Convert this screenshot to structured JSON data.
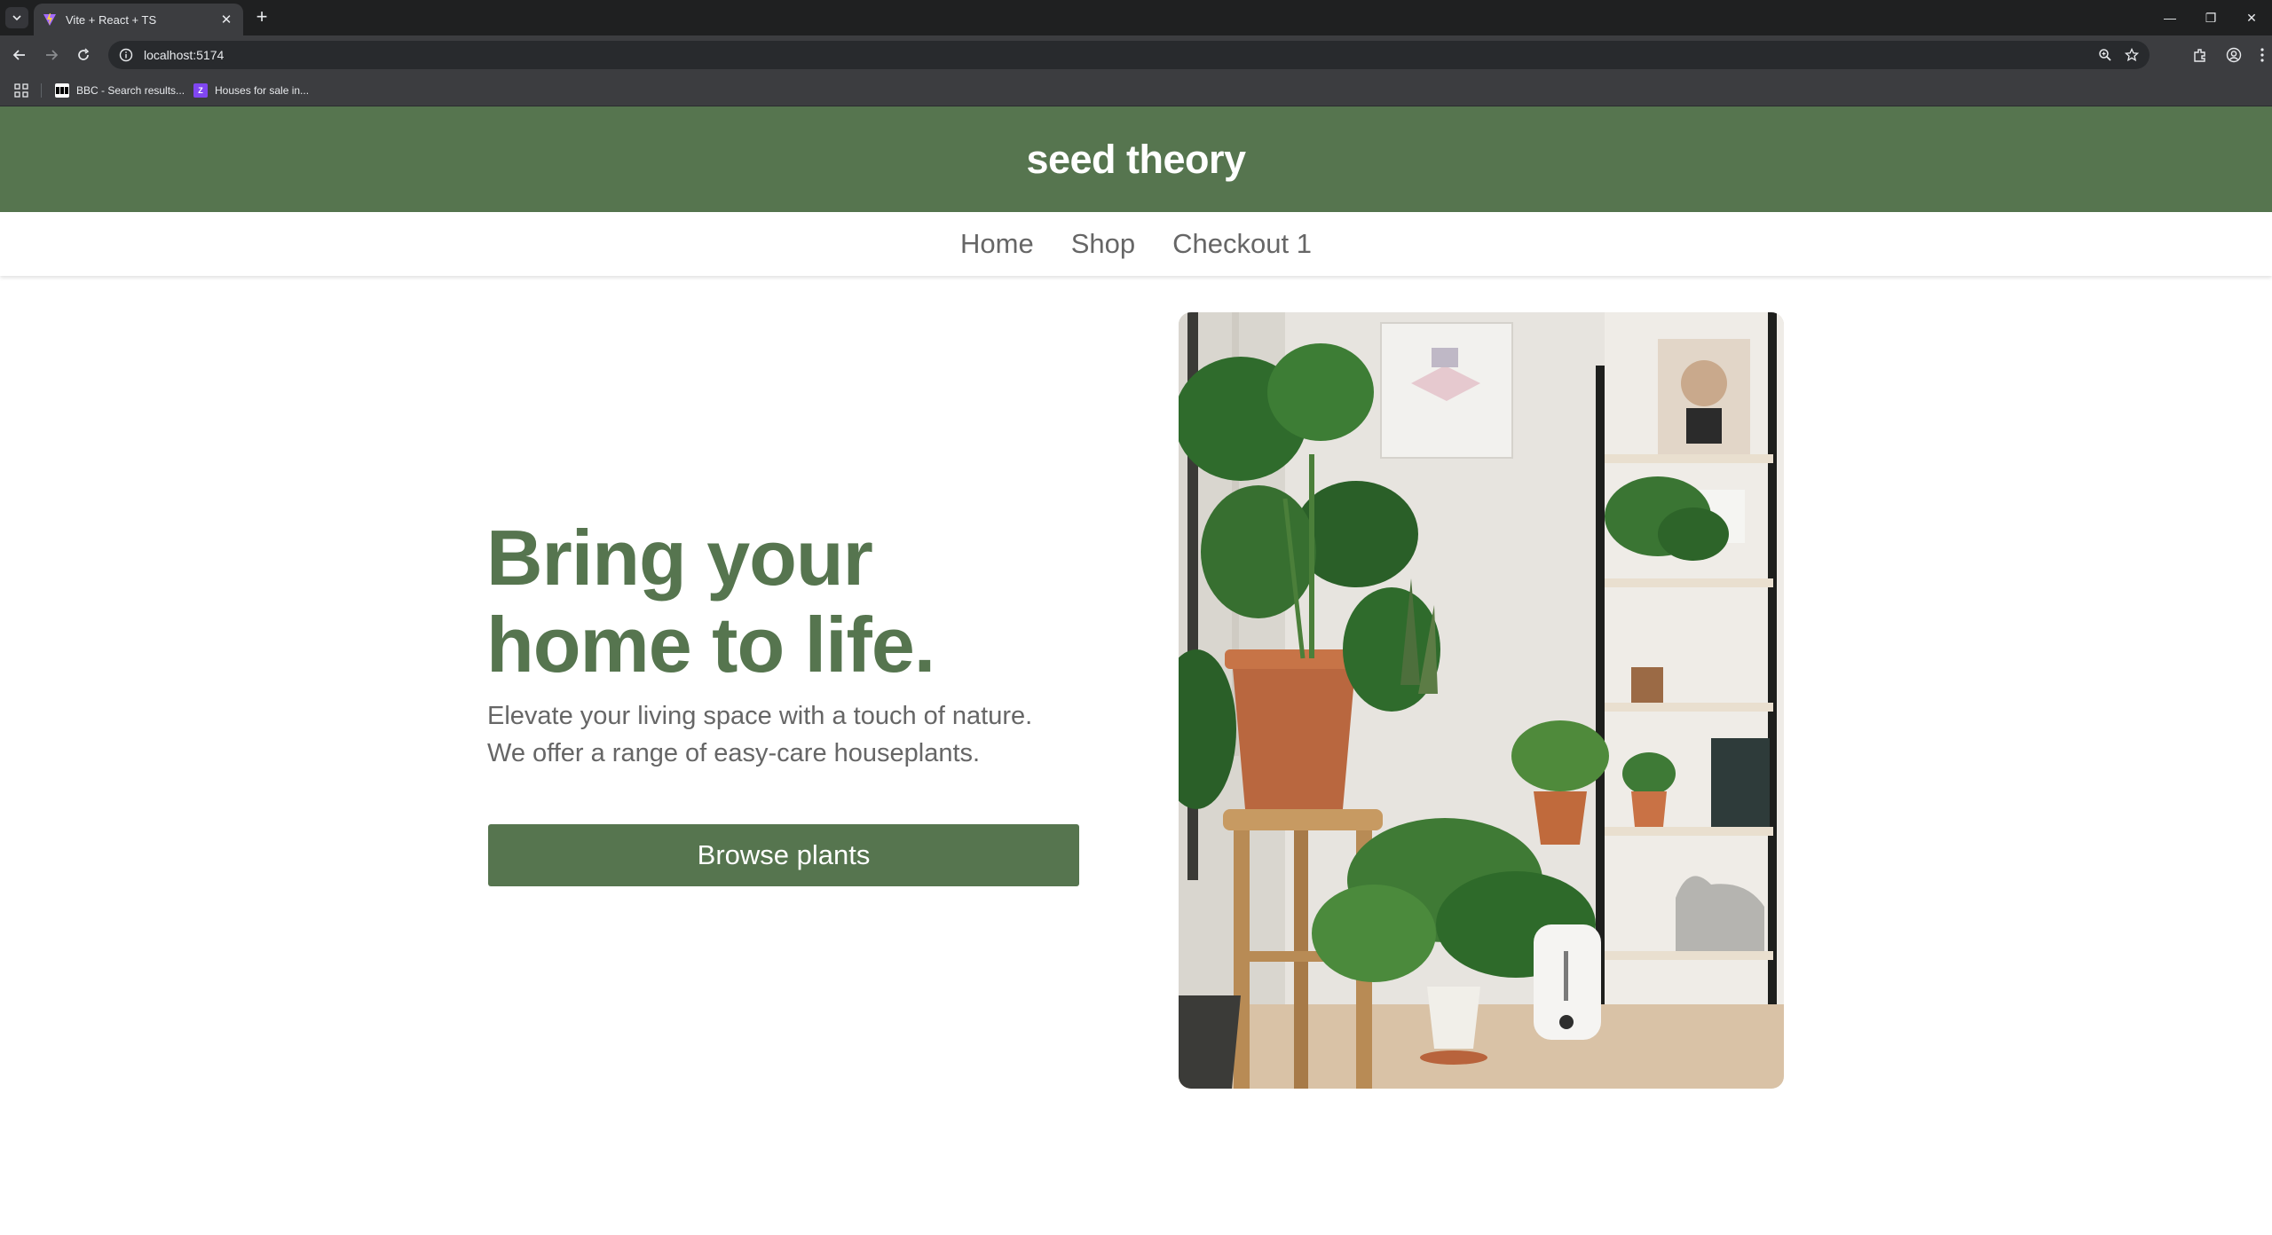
{
  "browser": {
    "tab_title": "Vite + React + TS",
    "url": "localhost:5174",
    "bookmarks": [
      {
        "label": "BBC - Search results...",
        "icon": "bbc-icon"
      },
      {
        "label": "Houses for sale in...",
        "icon": "zoopla-icon",
        "icon_text": "Z"
      }
    ]
  },
  "header": {
    "brand": "seed theory",
    "color": "#56754f"
  },
  "nav": {
    "items": [
      "Home",
      "Shop",
      "Checkout 1"
    ]
  },
  "hero": {
    "title_line1": "Bring your",
    "title_line2": "home to life.",
    "subtitle_line1": "Elevate your living space with a touch of nature.",
    "subtitle_line2": "We offer a range of easy-care houseplants.",
    "cta": "Browse plants"
  },
  "colors": {
    "accent": "#56754f",
    "text_muted": "#666666"
  }
}
